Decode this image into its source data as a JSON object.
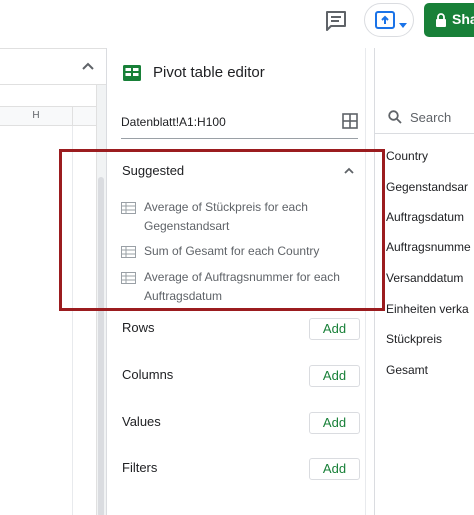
{
  "toolbar": {
    "share_label": "Sha",
    "accent": "#188038",
    "icons": [
      "comment-icon",
      "present-icon",
      "chevron-down-icon",
      "lock-icon"
    ]
  },
  "sheet": {
    "column_header": "H"
  },
  "editor": {
    "title": "Pivot table editor",
    "range": "Datenblatt!A1:H100",
    "suggested": {
      "title": "Suggested",
      "items": [
        {
          "line1": "Average of Stückpreis for each",
          "line2": "Gegenstandsart"
        },
        {
          "line1": "Sum of Gesamt for each Country",
          "line2": ""
        },
        {
          "line1": "Average of Auftragsnummer for each",
          "line2": "Auftragsdatum"
        }
      ]
    },
    "sections": [
      {
        "label": "Rows",
        "add": "Add"
      },
      {
        "label": "Columns",
        "add": "Add"
      },
      {
        "label": "Values",
        "add": "Add"
      },
      {
        "label": "Filters",
        "add": "Add"
      }
    ]
  },
  "fields": {
    "search_placeholder": "Search",
    "items": [
      "Country",
      "Gegenstandsar",
      "Auftragsdatum",
      "Auftragsnumme",
      "Versanddatum",
      "Einheiten verka",
      "Stückpreis",
      "Gesamt"
    ]
  },
  "annotation": {
    "color": "#9b1c1f"
  }
}
